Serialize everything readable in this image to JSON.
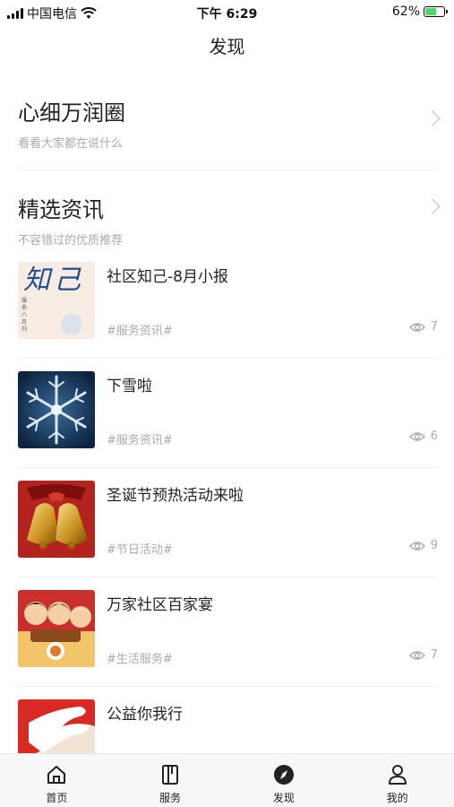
{
  "status_bar": {
    "carrier": "中国电信",
    "time": "下午 6:29",
    "battery": "62%",
    "battery_level": 0.62
  },
  "nav": {
    "title": "发现"
  },
  "circle_section": {
    "title": "心细万润圈",
    "subtitle": "看看大家都在说什么"
  },
  "news_section": {
    "title": "精选资讯",
    "subtitle": "不容错过的优质推荐",
    "items": [
      {
        "title": "社区知己-8月小报",
        "tag": "#服务资讯#",
        "views": "7",
        "thumb": "zhiji"
      },
      {
        "title": "下雪啦",
        "tag": "#服务资讯#",
        "views": "6",
        "thumb": "snowflake"
      },
      {
        "title": "圣诞节预热活动来啦",
        "tag": "#节日活动#",
        "views": "9",
        "thumb": "bells"
      },
      {
        "title": "万家社区百家宴",
        "tag": "#生活服务#",
        "views": "7",
        "thumb": "feast"
      },
      {
        "title": "公益你我行",
        "tag": "",
        "views": "",
        "thumb": "charity"
      }
    ]
  },
  "thumb_text": {
    "zhiji_main": "知己",
    "zhiji_sub": "服务·八月刊"
  },
  "tabbar": {
    "tabs": [
      {
        "label": "首页",
        "icon": "home-icon"
      },
      {
        "label": "服务",
        "icon": "book-icon"
      },
      {
        "label": "发现",
        "icon": "compass-icon"
      },
      {
        "label": "我的",
        "icon": "user-icon"
      }
    ],
    "active_index": 2
  }
}
